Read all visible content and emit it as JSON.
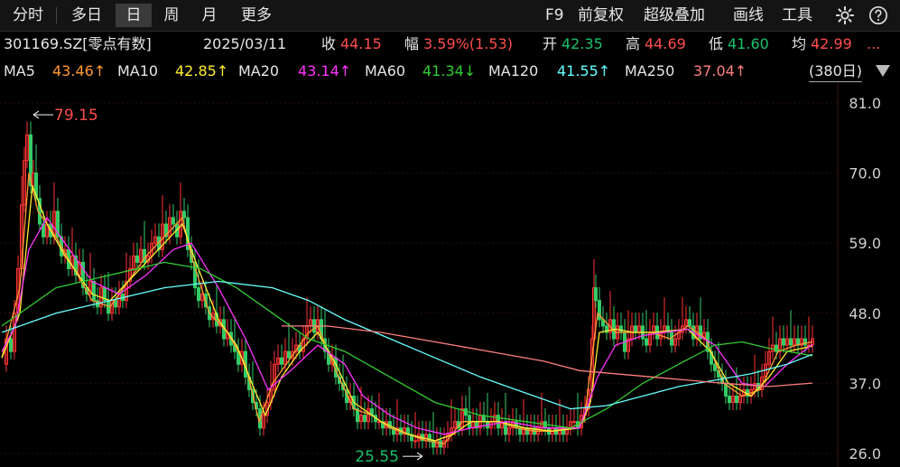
{
  "toolbar": {
    "tabs": [
      "分时",
      "多日",
      "日",
      "周",
      "月",
      "更多"
    ],
    "active_tab": "日",
    "right": [
      "F9",
      "前复权",
      "超级叠加",
      "画线",
      "工具"
    ]
  },
  "info": {
    "code_name": "301169.SZ[零点有数]",
    "date": "2025/03/11",
    "close_label": "收",
    "close": "44.15",
    "change_label": "幅",
    "change": "3.59%(1.53)",
    "open_label": "开",
    "open": "42.35",
    "high_label": "高",
    "high": "44.69",
    "low_label": "低",
    "low": "41.60",
    "avg_label": "均",
    "avg": "42.99",
    "more": "..."
  },
  "ma": [
    {
      "label": "MA5",
      "value": "43.46↑",
      "color": "#ff9933"
    },
    {
      "label": "MA10",
      "value": "42.85↑",
      "color": "#ffee33"
    },
    {
      "label": "MA20",
      "value": "43.14↑",
      "color": "#ff33ff"
    },
    {
      "label": "MA60",
      "value": "41.34↓",
      "color": "#33cc33"
    },
    {
      "label": "MA120",
      "value": "41.55↑",
      "color": "#66ffff"
    },
    {
      "label": "MA250",
      "value": "37.04↑",
      "color": "#ff7f7f"
    }
  ],
  "range_label": "(380日)",
  "chart_data": {
    "type": "line",
    "title": "301169.SZ[零点有数] daily candlestick (380 days)",
    "y_ticks": [
      "81.0",
      "70.0",
      "59.0",
      "48.0",
      "37.0",
      "26.0"
    ],
    "ylim": [
      26.0,
      81.0
    ],
    "max_label": "79.15",
    "min_label": "25.55",
    "close_path": [
      [
        0,
        40
      ],
      [
        5,
        44
      ],
      [
        10,
        42
      ],
      [
        14,
        48
      ],
      [
        18,
        55
      ],
      [
        22,
        65
      ],
      [
        25,
        72
      ],
      [
        28,
        76
      ],
      [
        32,
        68
      ],
      [
        35,
        70
      ],
      [
        38,
        66
      ],
      [
        42,
        62
      ],
      [
        46,
        60
      ],
      [
        50,
        62
      ],
      [
        54,
        60
      ],
      [
        58,
        64
      ],
      [
        62,
        60
      ],
      [
        66,
        57
      ],
      [
        70,
        58
      ],
      [
        74,
        55
      ],
      [
        78,
        57
      ],
      [
        82,
        54
      ],
      [
        86,
        56
      ],
      [
        90,
        52
      ],
      [
        94,
        51
      ],
      [
        98,
        53
      ],
      [
        102,
        50
      ],
      [
        106,
        49
      ],
      [
        110,
        52
      ],
      [
        114,
        50
      ],
      [
        118,
        48
      ],
      [
        122,
        50
      ],
      [
        126,
        49
      ],
      [
        130,
        51
      ],
      [
        134,
        50
      ],
      [
        138,
        53
      ],
      [
        142,
        55
      ],
      [
        146,
        57
      ],
      [
        150,
        56
      ],
      [
        154,
        58
      ],
      [
        158,
        56
      ],
      [
        162,
        57
      ],
      [
        166,
        59
      ],
      [
        170,
        60
      ],
      [
        174,
        58
      ],
      [
        178,
        62
      ],
      [
        182,
        60
      ],
      [
        186,
        63
      ],
      [
        190,
        62
      ],
      [
        194,
        60
      ],
      [
        198,
        64
      ],
      [
        202,
        63
      ],
      [
        206,
        58
      ],
      [
        210,
        56
      ],
      [
        214,
        52
      ],
      [
        218,
        50
      ],
      [
        222,
        51
      ],
      [
        226,
        49
      ],
      [
        230,
        47
      ],
      [
        234,
        48
      ],
      [
        238,
        46
      ],
      [
        242,
        47
      ],
      [
        246,
        44
      ],
      [
        250,
        45
      ],
      [
        254,
        43
      ],
      [
        258,
        42
      ],
      [
        262,
        40
      ],
      [
        266,
        42
      ],
      [
        270,
        38
      ],
      [
        274,
        36
      ],
      [
        278,
        34
      ],
      [
        282,
        33
      ],
      [
        286,
        30
      ],
      [
        290,
        32
      ],
      [
        294,
        34
      ],
      [
        298,
        36
      ],
      [
        302,
        40
      ],
      [
        306,
        41
      ],
      [
        310,
        40
      ],
      [
        314,
        42
      ],
      [
        318,
        41
      ],
      [
        322,
        42
      ],
      [
        326,
        43
      ],
      [
        330,
        42
      ],
      [
        334,
        44
      ],
      [
        338,
        46
      ],
      [
        342,
        47
      ],
      [
        346,
        45
      ],
      [
        350,
        47
      ],
      [
        354,
        44
      ],
      [
        358,
        42
      ],
      [
        362,
        40
      ],
      [
        366,
        41
      ],
      [
        370,
        38
      ],
      [
        374,
        37
      ],
      [
        378,
        36
      ],
      [
        382,
        34
      ],
      [
        386,
        35
      ],
      [
        390,
        33
      ],
      [
        394,
        31
      ],
      [
        398,
        32
      ],
      [
        402,
        31
      ],
      [
        406,
        33
      ],
      [
        410,
        32
      ],
      [
        414,
        31
      ],
      [
        418,
        31
      ],
      [
        422,
        30
      ],
      [
        426,
        31
      ],
      [
        430,
        30
      ],
      [
        434,
        29
      ],
      [
        438,
        30
      ],
      [
        442,
        29
      ],
      [
        446,
        30
      ],
      [
        450,
        29
      ],
      [
        454,
        28
      ],
      [
        458,
        28
      ],
      [
        462,
        29
      ],
      [
        466,
        28
      ],
      [
        470,
        29
      ],
      [
        474,
        28
      ],
      [
        478,
        27
      ],
      [
        482,
        28
      ],
      [
        486,
        27
      ],
      [
        490,
        28
      ],
      [
        494,
        29
      ],
      [
        498,
        30
      ],
      [
        502,
        31
      ],
      [
        506,
        30
      ],
      [
        510,
        33
      ],
      [
        514,
        32
      ],
      [
        518,
        30
      ],
      [
        522,
        31
      ],
      [
        526,
        30
      ],
      [
        530,
        32
      ],
      [
        534,
        31
      ],
      [
        538,
        30
      ],
      [
        542,
        31
      ],
      [
        546,
        32
      ],
      [
        550,
        30
      ],
      [
        554,
        31
      ],
      [
        558,
        29
      ],
      [
        562,
        30
      ],
      [
        566,
        31
      ],
      [
        570,
        30
      ],
      [
        574,
        29
      ],
      [
        578,
        30
      ],
      [
        582,
        29
      ],
      [
        586,
        30
      ],
      [
        590,
        29
      ],
      [
        594,
        30
      ],
      [
        598,
        31
      ],
      [
        602,
        30
      ],
      [
        606,
        29
      ],
      [
        610,
        30
      ],
      [
        614,
        29
      ],
      [
        618,
        30
      ],
      [
        622,
        29
      ],
      [
        626,
        30
      ],
      [
        630,
        31
      ],
      [
        634,
        31
      ],
      [
        638,
        30
      ],
      [
        642,
        32
      ],
      [
        646,
        33
      ],
      [
        650,
        36
      ],
      [
        654,
        44
      ],
      [
        656,
        52
      ],
      [
        658,
        50
      ],
      [
        662,
        47
      ],
      [
        666,
        46
      ],
      [
        670,
        45
      ],
      [
        674,
        47
      ],
      [
        678,
        44
      ],
      [
        682,
        46
      ],
      [
        686,
        45
      ],
      [
        690,
        42
      ],
      [
        694,
        44
      ],
      [
        698,
        46
      ],
      [
        702,
        45
      ],
      [
        706,
        46
      ],
      [
        710,
        44
      ],
      [
        714,
        43
      ],
      [
        718,
        45
      ],
      [
        722,
        46
      ],
      [
        726,
        44
      ],
      [
        730,
        45
      ],
      [
        734,
        46
      ],
      [
        738,
        45
      ],
      [
        742,
        43
      ],
      [
        746,
        44
      ],
      [
        750,
        45
      ],
      [
        754,
        46
      ],
      [
        758,
        47
      ],
      [
        762,
        46
      ],
      [
        766,
        44
      ],
      [
        770,
        46
      ],
      [
        774,
        44
      ],
      [
        778,
        45
      ],
      [
        782,
        42
      ],
      [
        786,
        40
      ],
      [
        790,
        39
      ],
      [
        794,
        38
      ],
      [
        798,
        37
      ],
      [
        802,
        35
      ],
      [
        806,
        34
      ],
      [
        810,
        35
      ],
      [
        814,
        34
      ],
      [
        818,
        35
      ],
      [
        822,
        36
      ],
      [
        826,
        35
      ],
      [
        830,
        36
      ],
      [
        834,
        37
      ],
      [
        838,
        36
      ],
      [
        842,
        38
      ],
      [
        846,
        40
      ],
      [
        850,
        42
      ],
      [
        854,
        43
      ],
      [
        858,
        42
      ],
      [
        862,
        44
      ],
      [
        866,
        43
      ],
      [
        870,
        44
      ],
      [
        874,
        43
      ],
      [
        878,
        44
      ],
      [
        882,
        43
      ],
      [
        886,
        44
      ],
      [
        890,
        43
      ],
      [
        894,
        43
      ],
      [
        898,
        44
      ]
    ],
    "ma_lines": {
      "MA5": [
        [
          0,
          41
        ],
        [
          20,
          52
        ],
        [
          30,
          70
        ],
        [
          40,
          64
        ],
        [
          60,
          60
        ],
        [
          80,
          55
        ],
        [
          100,
          50
        ],
        [
          120,
          49
        ],
        [
          140,
          53
        ],
        [
          160,
          57
        ],
        [
          180,
          60
        ],
        [
          200,
          63
        ],
        [
          210,
          57
        ],
        [
          230,
          48
        ],
        [
          250,
          45
        ],
        [
          270,
          40
        ],
        [
          285,
          31
        ],
        [
          300,
          37
        ],
        [
          320,
          41
        ],
        [
          340,
          45
        ],
        [
          350,
          46
        ],
        [
          370,
          39
        ],
        [
          390,
          33
        ],
        [
          410,
          32
        ],
        [
          430,
          30
        ],
        [
          450,
          29
        ],
        [
          470,
          28
        ],
        [
          490,
          27.5
        ],
        [
          510,
          31
        ],
        [
          530,
          31
        ],
        [
          550,
          31
        ],
        [
          570,
          30
        ],
        [
          590,
          29.5
        ],
        [
          610,
          29.5
        ],
        [
          630,
          30
        ],
        [
          645,
          31
        ],
        [
          652,
          39
        ],
        [
          660,
          48
        ],
        [
          680,
          45
        ],
        [
          700,
          45
        ],
        [
          720,
          45
        ],
        [
          740,
          44
        ],
        [
          760,
          46
        ],
        [
          780,
          44
        ],
        [
          800,
          37
        ],
        [
          820,
          35
        ],
        [
          840,
          36
        ],
        [
          860,
          42
        ],
        [
          880,
          43
        ],
        [
          898,
          43.5
        ]
      ],
      "MA10": [
        [
          0,
          41
        ],
        [
          20,
          48
        ],
        [
          34,
          68
        ],
        [
          50,
          62
        ],
        [
          70,
          57
        ],
        [
          100,
          51
        ],
        [
          120,
          50
        ],
        [
          140,
          53
        ],
        [
          160,
          56
        ],
        [
          180,
          59
        ],
        [
          200,
          62
        ],
        [
          215,
          56
        ],
        [
          240,
          47
        ],
        [
          260,
          43
        ],
        [
          280,
          36
        ],
        [
          292,
          32
        ],
        [
          310,
          38
        ],
        [
          330,
          42
        ],
        [
          350,
          45
        ],
        [
          370,
          40
        ],
        [
          390,
          34
        ],
        [
          420,
          31
        ],
        [
          450,
          29
        ],
        [
          480,
          28
        ],
        [
          500,
          29
        ],
        [
          520,
          31
        ],
        [
          550,
          31
        ],
        [
          580,
          30
        ],
        [
          610,
          29.5
        ],
        [
          640,
          30
        ],
        [
          652,
          34
        ],
        [
          662,
          45
        ],
        [
          680,
          45.5
        ],
        [
          700,
          45
        ],
        [
          720,
          45
        ],
        [
          760,
          45.5
        ],
        [
          785,
          42
        ],
        [
          805,
          37
        ],
        [
          830,
          35
        ],
        [
          850,
          38
        ],
        [
          870,
          42
        ],
        [
          898,
          42.85
        ]
      ],
      "MA20": [
        [
          0,
          42
        ],
        [
          15,
          46
        ],
        [
          30,
          58
        ],
        [
          50,
          63
        ],
        [
          70,
          59
        ],
        [
          100,
          53
        ],
        [
          130,
          51
        ],
        [
          160,
          54
        ],
        [
          190,
          58
        ],
        [
          210,
          59
        ],
        [
          240,
          52
        ],
        [
          270,
          44
        ],
        [
          295,
          36
        ],
        [
          320,
          39
        ],
        [
          350,
          43
        ],
        [
          380,
          40
        ],
        [
          400,
          35
        ],
        [
          430,
          32
        ],
        [
          460,
          30
        ],
        [
          490,
          29
        ],
        [
          520,
          30
        ],
        [
          560,
          31
        ],
        [
          600,
          30
        ],
        [
          640,
          30
        ],
        [
          660,
          38
        ],
        [
          680,
          43
        ],
        [
          710,
          44.5
        ],
        [
          760,
          45.5
        ],
        [
          790,
          43
        ],
        [
          820,
          37
        ],
        [
          845,
          36.5
        ],
        [
          870,
          40
        ],
        [
          898,
          43.14
        ]
      ],
      "MA60": [
        [
          0,
          46
        ],
        [
          60,
          52
        ],
        [
          120,
          54
        ],
        [
          180,
          56
        ],
        [
          220,
          55
        ],
        [
          260,
          52
        ],
        [
          300,
          48
        ],
        [
          340,
          44
        ],
        [
          380,
          42
        ],
        [
          430,
          38
        ],
        [
          480,
          34
        ],
        [
          530,
          32
        ],
        [
          580,
          31
        ],
        [
          630,
          30
        ],
        [
          670,
          33
        ],
        [
          710,
          37
        ],
        [
          750,
          40
        ],
        [
          790,
          43
        ],
        [
          820,
          43.5
        ],
        [
          850,
          42.5
        ],
        [
          898,
          41.34
        ]
      ],
      "MA120": [
        [
          0,
          45
        ],
        [
          60,
          48
        ],
        [
          120,
          50
        ],
        [
          180,
          52
        ],
        [
          240,
          53
        ],
        [
          300,
          52
        ],
        [
          340,
          50
        ],
        [
          380,
          47
        ],
        [
          430,
          44
        ],
        [
          480,
          41
        ],
        [
          530,
          38
        ],
        [
          580,
          35.5
        ],
        [
          630,
          33
        ],
        [
          670,
          33.5
        ],
        [
          710,
          35
        ],
        [
          750,
          36.5
        ],
        [
          790,
          37.5
        ],
        [
          830,
          38.5
        ],
        [
          870,
          40
        ],
        [
          898,
          41.55
        ]
      ],
      "MA250": [
        [
          310,
          46
        ],
        [
          360,
          46
        ],
        [
          420,
          45
        ],
        [
          480,
          43.5
        ],
        [
          540,
          42
        ],
        [
          600,
          40.5
        ],
        [
          640,
          39
        ],
        [
          680,
          38.5
        ],
        [
          720,
          38
        ],
        [
          760,
          37.5
        ],
        [
          800,
          37
        ],
        [
          850,
          36.5
        ],
        [
          898,
          37.04
        ]
      ]
    }
  }
}
